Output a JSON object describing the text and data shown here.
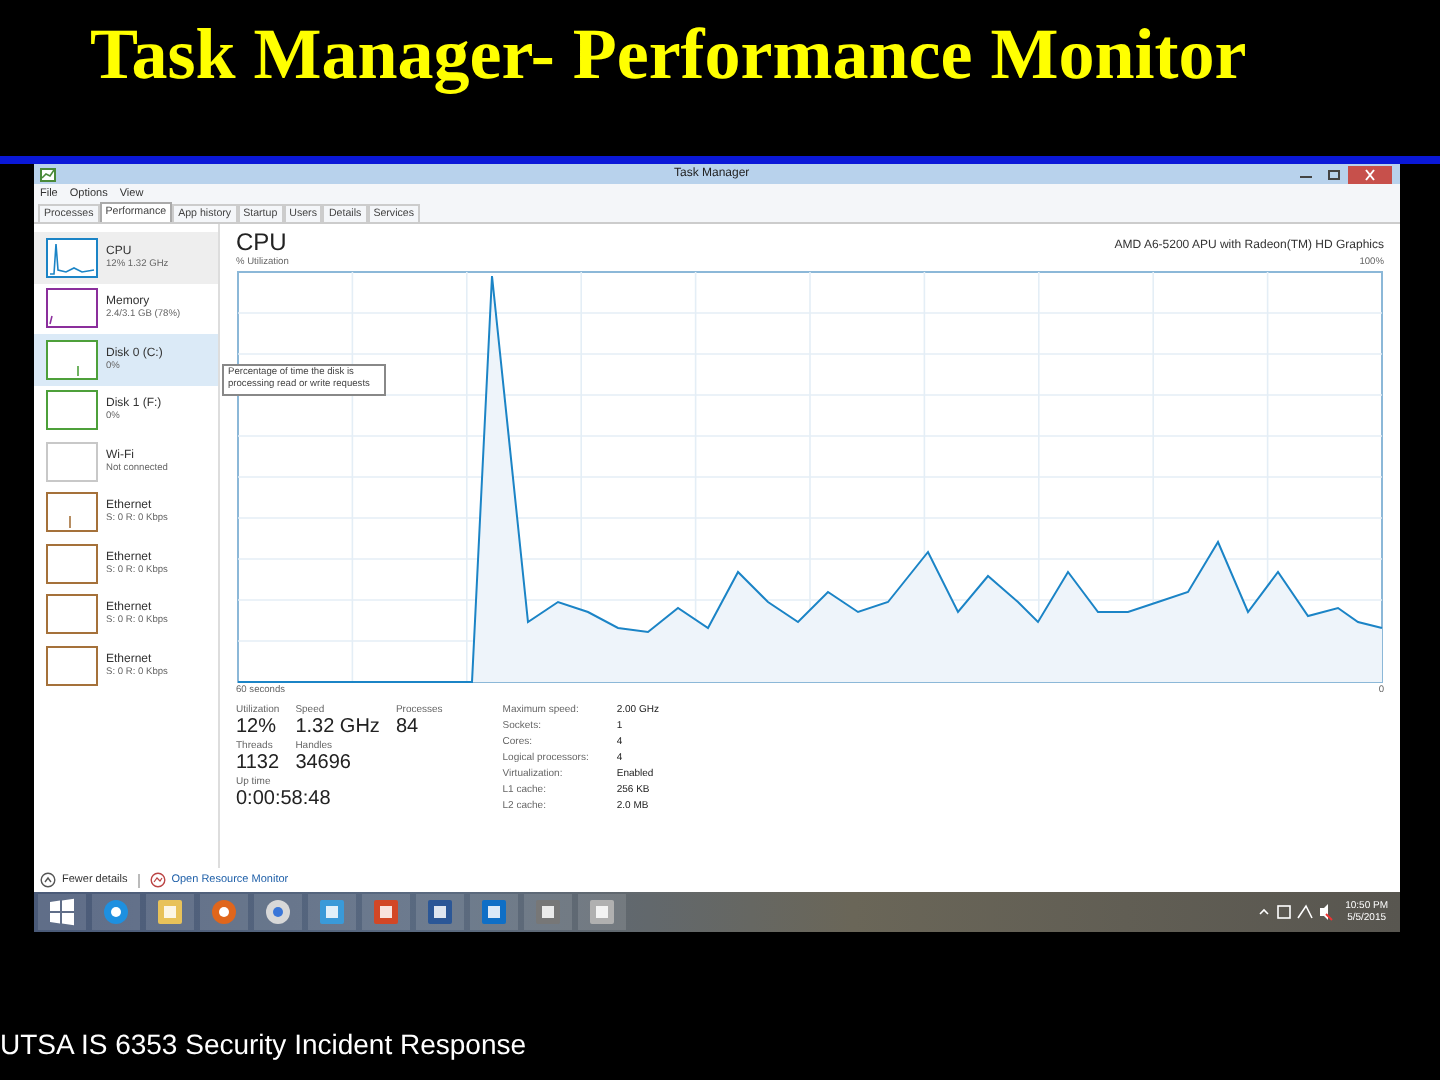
{
  "slide": {
    "title": "Task Manager- Performance Monitor",
    "footer": "UTSA IS 6353 Security Incident Response"
  },
  "window": {
    "title": "Task Manager"
  },
  "menu": [
    "File",
    "Options",
    "View"
  ],
  "tabs": [
    {
      "label": "Processes",
      "selected": false
    },
    {
      "label": "Performance",
      "selected": true
    },
    {
      "label": "App history",
      "selected": false
    },
    {
      "label": "Startup",
      "selected": false
    },
    {
      "label": "Users",
      "selected": false
    },
    {
      "label": "Details",
      "selected": false
    },
    {
      "label": "Services",
      "selected": false
    }
  ],
  "sidebar": {
    "items": [
      {
        "name": "CPU",
        "detail": "12% 1.32 GHz",
        "color": "#1b84c6",
        "selected": true,
        "hovered": false
      },
      {
        "name": "Memory",
        "detail": "2.4/3.1 GB (78%)",
        "color": "#8b2e9c",
        "selected": false,
        "hovered": false
      },
      {
        "name": "Disk 0 (C:)",
        "detail": "0%",
        "color": "#4da03a",
        "selected": false,
        "hovered": true
      },
      {
        "name": "Disk 1 (F:)",
        "detail": "0%",
        "color": "#4da03a",
        "selected": false,
        "hovered": false
      },
      {
        "name": "Wi-Fi",
        "detail": "Not connected",
        "color": "#c8c8c8",
        "selected": false,
        "hovered": false
      },
      {
        "name": "Ethernet",
        "detail": "S: 0 R: 0 Kbps",
        "color": "#a5713a",
        "selected": false,
        "hovered": false
      },
      {
        "name": "Ethernet",
        "detail": "S: 0 R: 0 Kbps",
        "color": "#a5713a",
        "selected": false,
        "hovered": false
      },
      {
        "name": "Ethernet",
        "detail": "S: 0 R: 0 Kbps",
        "color": "#a5713a",
        "selected": false,
        "hovered": false
      },
      {
        "name": "Ethernet",
        "detail": "S: 0 R: 0 Kbps",
        "color": "#a5713a",
        "selected": false,
        "hovered": false
      }
    ],
    "tooltip": "Percentage of time the disk is processing read or write requests"
  },
  "detail": {
    "title": "CPU",
    "processor": "AMD A6-5200 APU with Radeon(TM) HD Graphics",
    "graph_label": "% Utilization",
    "graph_max": "100%",
    "graph_span": "60 seconds",
    "graph_min": "0",
    "stats": [
      {
        "label": "Utilization",
        "value": "12%"
      },
      {
        "label": "Speed",
        "value": "1.32 GHz"
      },
      {
        "label": "Processes",
        "value": "84"
      },
      {
        "label": "Threads",
        "value": "1132"
      },
      {
        "label": "Handles",
        "value": "34696"
      },
      {
        "label": "Up time",
        "value": "0:00:58:48"
      }
    ],
    "specs": [
      {
        "label": "Maximum speed:",
        "value": "2.00 GHz"
      },
      {
        "label": "Sockets:",
        "value": "1"
      },
      {
        "label": "Cores:",
        "value": "4"
      },
      {
        "label": "Logical processors:",
        "value": "4"
      },
      {
        "label": "Virtualization:",
        "value": "Enabled"
      },
      {
        "label": "L1 cache:",
        "value": "256 KB"
      },
      {
        "label": "L2 cache:",
        "value": "2.0 MB"
      }
    ]
  },
  "footer": {
    "fewer": "Fewer details",
    "monitor": "Open Resource Monitor"
  },
  "taskbar": {
    "apps": [
      {
        "kind": "start"
      },
      {
        "kind": "browser-e"
      },
      {
        "kind": "folder"
      },
      {
        "kind": "fox"
      },
      {
        "kind": "chrome"
      },
      {
        "kind": "bird"
      },
      {
        "kind": "slides"
      },
      {
        "kind": "doc"
      },
      {
        "kind": "mail"
      },
      {
        "kind": "device"
      },
      {
        "kind": "monitor"
      }
    ],
    "time": "10:50 PM",
    "date": "5/5/2015"
  }
}
